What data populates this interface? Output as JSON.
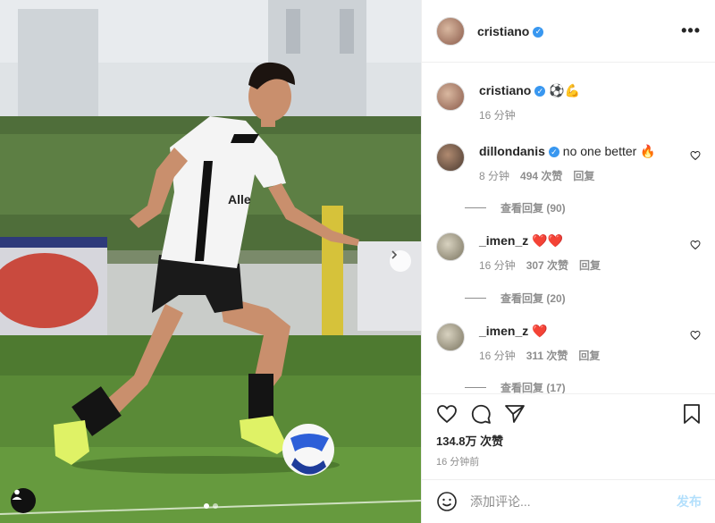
{
  "post": {
    "username": "cristiano",
    "more_glyph": "•••",
    "caption_emoji": "⚽💪",
    "caption_time": "16 分钟"
  },
  "comments": [
    {
      "username": "dillondanis",
      "verified": true,
      "text": "no one better 🔥",
      "time": "8 分钟",
      "likes": "494 次赞",
      "reply": "回复",
      "view_replies": "查看回复 (90)"
    },
    {
      "username": "_imen_z",
      "verified": false,
      "text": "❤️❤️",
      "time": "16 分钟",
      "likes": "307 次赞",
      "reply": "回复",
      "view_replies": "查看回复 (20)"
    },
    {
      "username": "_imen_z",
      "verified": false,
      "text": "❤️",
      "time": "16 分钟",
      "likes": "311 次赞",
      "reply": "回复",
      "view_replies": "查看回复 (17)"
    }
  ],
  "actions": {
    "likes_count": "134.8万 次赞",
    "posted_time": "16 分钟前"
  },
  "add_comment": {
    "placeholder": "添加评论...",
    "post_label": "发布"
  },
  "media": {
    "jersey_text": "Alle",
    "slide_count": 2,
    "active_slide": 1
  },
  "colors": {
    "verified": "#3897f0",
    "post_disabled": "#b2dffc",
    "secondary_text": "#8e8e8e"
  }
}
